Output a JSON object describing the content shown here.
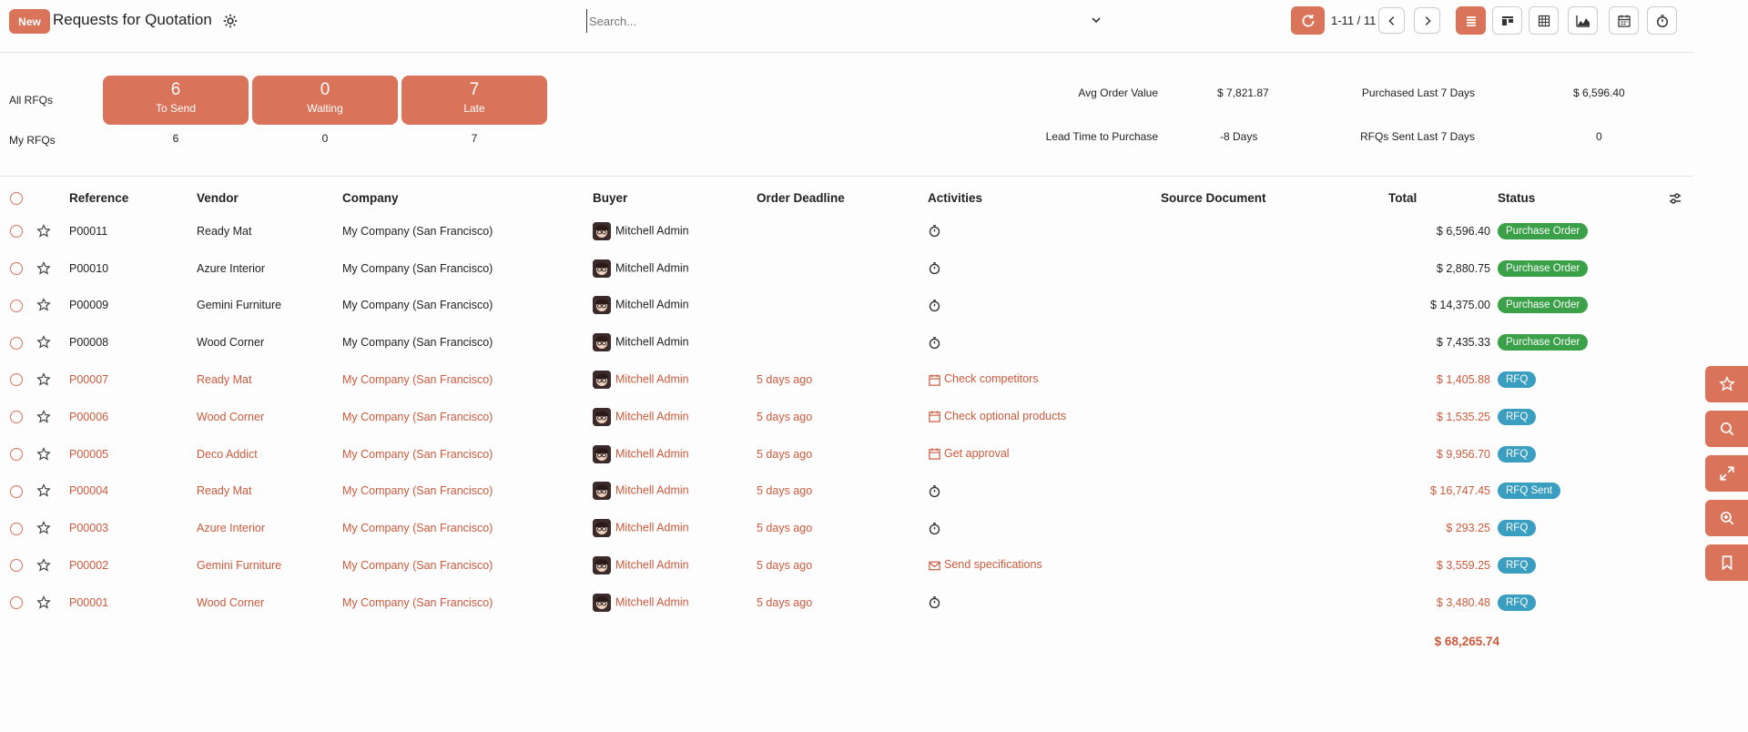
{
  "header": {
    "new_label": "New",
    "title": "Requests for Quotation",
    "search_placeholder": "Search...",
    "pager": "1-11 / 11"
  },
  "views": [
    "list-icon",
    "kanban-icon",
    "pivot-icon",
    "graph-icon",
    "calendar-icon",
    "activity-icon"
  ],
  "dashboard": {
    "all_label": "All RFQs",
    "my_label": "My RFQs",
    "cards": [
      {
        "count": "6",
        "label": "To Send",
        "mine": "6"
      },
      {
        "count": "0",
        "label": "Waiting",
        "mine": "0"
      },
      {
        "count": "7",
        "label": "Late",
        "mine": "7"
      }
    ],
    "stats": {
      "avg_order_label": "Avg Order Value",
      "avg_order_value": "$ 7,821.87",
      "purchased_label": "Purchased Last 7 Days",
      "purchased_value": "$ 6,596.40",
      "lead_time_label": "Lead Time to Purchase",
      "lead_time_value": "-8 Days",
      "rfq_sent_label": "RFQs Sent Last 7 Days",
      "rfq_sent_value": "0"
    }
  },
  "table": {
    "columns": {
      "reference": "Reference",
      "vendor": "Vendor",
      "company": "Company",
      "buyer": "Buyer",
      "deadline": "Order Deadline",
      "activities": "Activities",
      "source": "Source Document",
      "total": "Total",
      "status": "Status"
    },
    "rows": [
      {
        "ref": "P00011",
        "vendor": "Ready Mat",
        "company": "My Company (San Francisco)",
        "buyer": "Mitchell Admin",
        "deadline": "",
        "activity": "",
        "activity_icon": "clock-icon",
        "total": "$ 6,596.40",
        "status": "Purchase Order",
        "late": false
      },
      {
        "ref": "P00010",
        "vendor": "Azure Interior",
        "company": "My Company (San Francisco)",
        "buyer": "Mitchell Admin",
        "deadline": "",
        "activity": "",
        "activity_icon": "clock-icon",
        "total": "$ 2,880.75",
        "status": "Purchase Order",
        "late": false
      },
      {
        "ref": "P00009",
        "vendor": "Gemini Furniture",
        "company": "My Company (San Francisco)",
        "buyer": "Mitchell Admin",
        "deadline": "",
        "activity": "",
        "activity_icon": "clock-icon",
        "total": "$ 14,375.00",
        "status": "Purchase Order",
        "late": false
      },
      {
        "ref": "P00008",
        "vendor": "Wood Corner",
        "company": "My Company (San Francisco)",
        "buyer": "Mitchell Admin",
        "deadline": "",
        "activity": "",
        "activity_icon": "clock-icon",
        "total": "$ 7,435.33",
        "status": "Purchase Order",
        "late": false
      },
      {
        "ref": "P00007",
        "vendor": "Ready Mat",
        "company": "My Company (San Francisco)",
        "buyer": "Mitchell Admin",
        "deadline": "5 days ago",
        "activity": "Check competitors",
        "activity_icon": "calendar-icon",
        "total": "$ 1,405.88",
        "status": "RFQ",
        "late": true
      },
      {
        "ref": "P00006",
        "vendor": "Wood Corner",
        "company": "My Company (San Francisco)",
        "buyer": "Mitchell Admin",
        "deadline": "5 days ago",
        "activity": "Check optional products",
        "activity_icon": "calendar-icon",
        "total": "$ 1,535.25",
        "status": "RFQ",
        "late": true
      },
      {
        "ref": "P00005",
        "vendor": "Deco Addict",
        "company": "My Company (San Francisco)",
        "buyer": "Mitchell Admin",
        "deadline": "5 days ago",
        "activity": "Get approval",
        "activity_icon": "calendar-icon",
        "total": "$ 9,956.70",
        "status": "RFQ",
        "late": true
      },
      {
        "ref": "P00004",
        "vendor": "Ready Mat",
        "company": "My Company (San Francisco)",
        "buyer": "Mitchell Admin",
        "deadline": "5 days ago",
        "activity": "",
        "activity_icon": "clock-icon",
        "total": "$ 16,747.45",
        "status": "RFQ Sent",
        "late": true
      },
      {
        "ref": "P00003",
        "vendor": "Azure Interior",
        "company": "My Company (San Francisco)",
        "buyer": "Mitchell Admin",
        "deadline": "5 days ago",
        "activity": "",
        "activity_icon": "clock-icon",
        "total": "$ 293.25",
        "status": "RFQ",
        "late": true
      },
      {
        "ref": "P00002",
        "vendor": "Gemini Furniture",
        "company": "My Company (San Francisco)",
        "buyer": "Mitchell Admin",
        "deadline": "5 days ago",
        "activity": "Send specifications",
        "activity_icon": "envelope-icon",
        "total": "$ 3,559.25",
        "status": "RFQ",
        "late": true
      },
      {
        "ref": "P00001",
        "vendor": "Wood Corner",
        "company": "My Company (San Francisco)",
        "buyer": "Mitchell Admin",
        "deadline": "5 days ago",
        "activity": "",
        "activity_icon": "clock-icon",
        "total": "$ 3,480.48",
        "status": "RFQ",
        "late": true
      }
    ],
    "grand_total": "$ 68,265.74"
  },
  "side_tools": [
    "star-icon",
    "search-icon",
    "expand-icon",
    "zoom-icon",
    "bookmark-icon"
  ],
  "colors": {
    "accent": "#d9735a",
    "late_text": "#cc5a3c",
    "po_badge": "#3aa149",
    "rfq_badge": "#3a9ec0"
  }
}
